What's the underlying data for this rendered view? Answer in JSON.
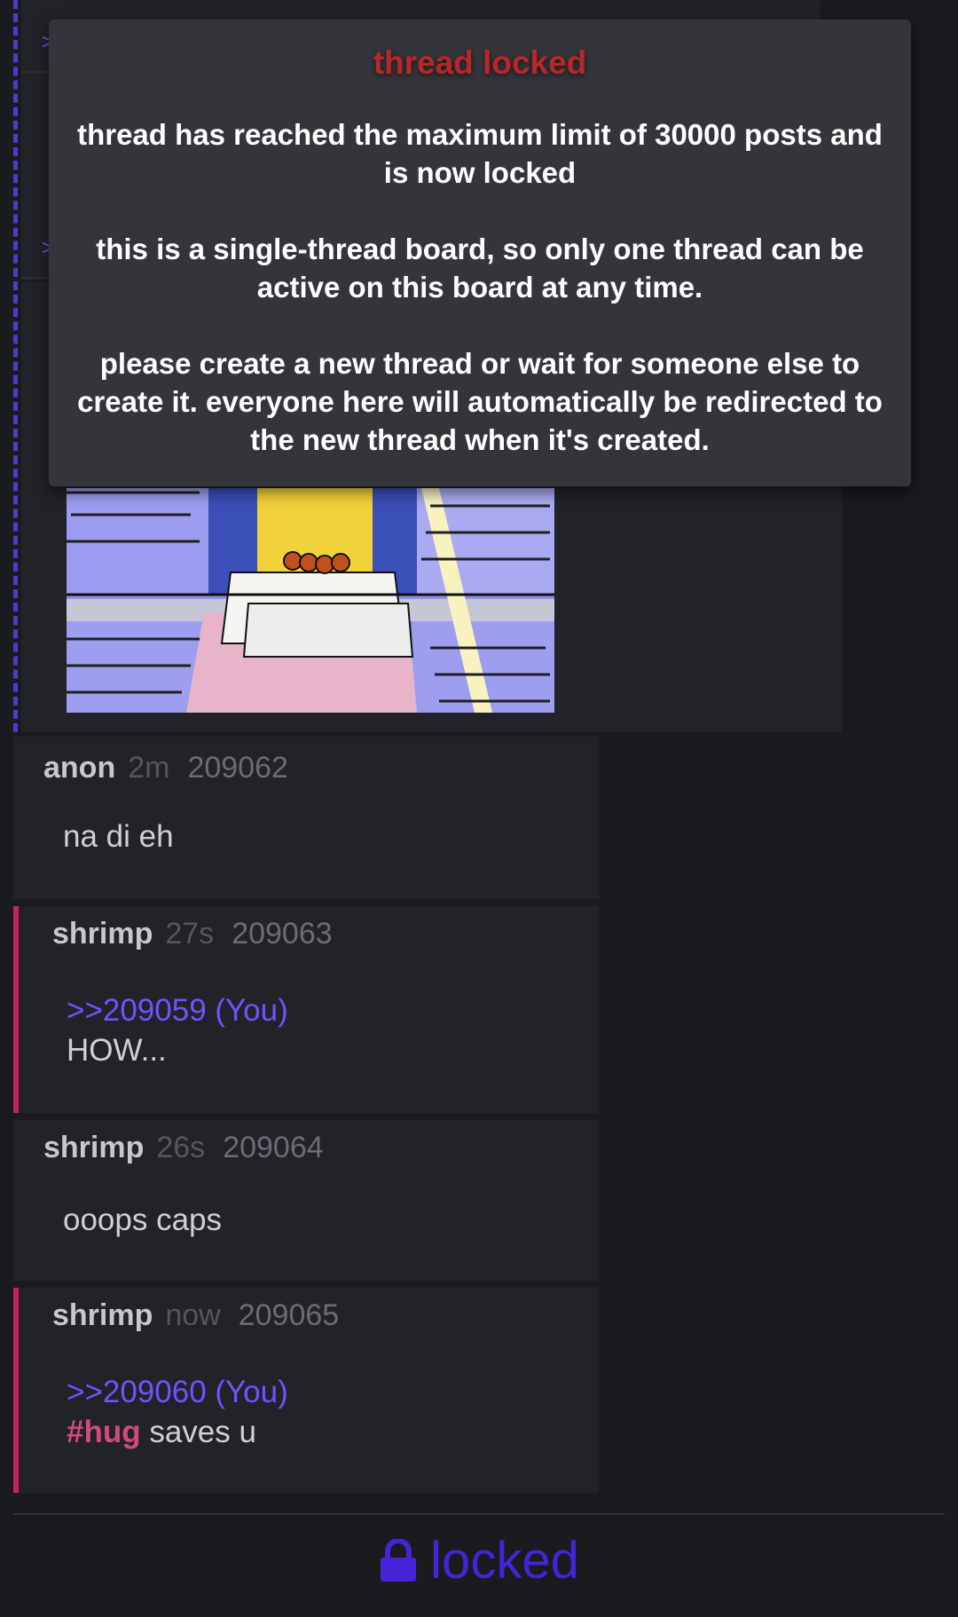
{
  "modal": {
    "title": "thread locked",
    "line1": "thread has reached the maximum limit of 30000 posts and is now locked",
    "line2": "this is a single-thread board, so only one thread can be active on this board at any time.",
    "line3": "please create a new thread or wait for someone else to create it. everyone here will automatically be redirected to the new thread when it's created."
  },
  "posts": [
    {
      "name": "anon",
      "time": "2m",
      "number": "209062",
      "body": "na di eh",
      "is_you": false
    },
    {
      "name": "shrimp",
      "time": "27s",
      "number": "209063",
      "quote": ">>209059 (You)",
      "body": "HOW...",
      "is_you": true
    },
    {
      "name": "shrimp",
      "time": "26s",
      "number": "209064",
      "body": "ooops caps",
      "is_you": false
    },
    {
      "name": "shrimp",
      "time": "now",
      "number": "209065",
      "quote": ">>209060 (You)",
      "hashtag": "#hug",
      "body": " saves u",
      "is_you": true
    }
  ],
  "footer": {
    "locked_label": "locked",
    "lock_icon": "lock-icon"
  },
  "colors": {
    "background": "#1a1b1f",
    "post_bg": "#222328",
    "modal_bg": "#34353b",
    "title_red": "#b82727",
    "quote_link": "#6a55ff",
    "you_border": "#c8245c",
    "hashtag": "#d24a78",
    "locked_accent": "#4424d6"
  }
}
